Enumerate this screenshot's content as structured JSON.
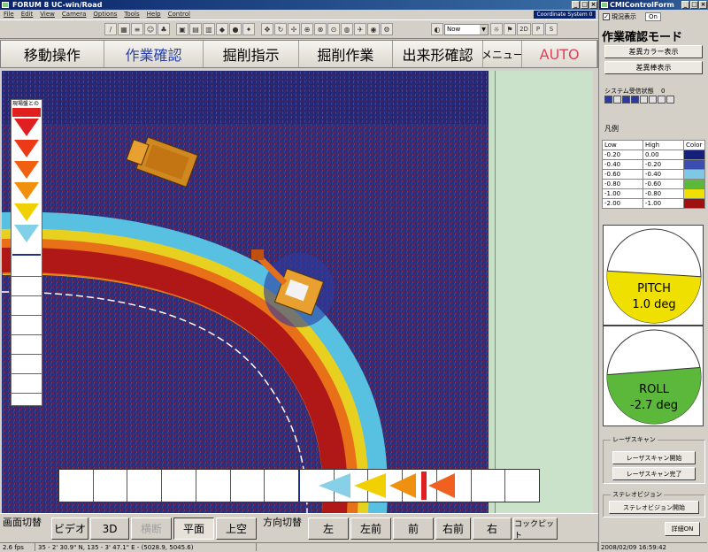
{
  "app": {
    "title": "FORUM 8   UC-win/Road"
  },
  "menu": [
    "File",
    "Edit",
    "View",
    "Camera",
    "Options",
    "Tools",
    "Help",
    "Control"
  ],
  "coord_system": "Coordinate System 0",
  "time_select": "Now",
  "view_buttons": [
    "2D",
    "P",
    "S"
  ],
  "modes": [
    {
      "label": "移動操作",
      "active": false
    },
    {
      "label": "作業確認",
      "active": true
    },
    {
      "label": "掘削指示",
      "active": false
    },
    {
      "label": "掘削作業",
      "active": false
    },
    {
      "label": "出来形確認",
      "active": false
    },
    {
      "label": "メニュー",
      "active": false
    },
    {
      "label": "AUTO",
      "active": false,
      "color": "#e0405a"
    }
  ],
  "legend_title": "現場盤との",
  "bottom_bar": {
    "screen_switch_label": "画面切替",
    "screen_buttons": [
      {
        "label": "ビデオ",
        "state": "normal"
      },
      {
        "label": "3D",
        "state": "normal"
      },
      {
        "label": "横断",
        "state": "disabled"
      },
      {
        "label": "平面",
        "state": "active"
      },
      {
        "label": "上空",
        "state": "normal"
      }
    ],
    "direction_switch_label": "方向切替",
    "direction_buttons": [
      "左",
      "左前",
      "前",
      "右前",
      "右",
      "コックピット"
    ]
  },
  "status": {
    "fps": "2.6 fps",
    "coords": "35 - 2' 30.9\" N, 135 - 3' 47.1\" E  -  (5028.9, 5045.6)",
    "datetime": "2008/02/09 16:59:42"
  },
  "panel": {
    "title": "CMIControlForm",
    "checkbox_label": "現況表示",
    "toggle": "On",
    "mode_title": "作業確認モード",
    "btn_color": "差異カラー表示",
    "btn_bar": "差異棒表示",
    "system_status_label": "システム受信状態",
    "system_status_value": "0",
    "legend_label": "凡例",
    "legend_headers": [
      "Low",
      "High",
      "Color"
    ],
    "legend_rows": [
      {
        "low": "-0.20",
        "high": "0.00",
        "color": "#14207a"
      },
      {
        "low": "-0.40",
        "high": "-0.20",
        "color": "#3b4db0"
      },
      {
        "low": "-0.60",
        "high": "-0.40",
        "color": "#7ec8e3"
      },
      {
        "low": "-0.80",
        "high": "-0.60",
        "color": "#5bb83a"
      },
      {
        "low": "-1.00",
        "high": "-0.80",
        "color": "#f0e000"
      },
      {
        "low": "-2.00",
        "high": "-1.00",
        "color": "#a01010"
      }
    ],
    "pitch_label": "PITCH",
    "pitch_value": "1.0 deg",
    "pitch_level": 0.45,
    "roll_label": "ROLL",
    "roll_value": "-2.7 deg",
    "roll_level": 0.45,
    "laser_group": "レーザスキャン",
    "laser_start": "レーザスキャン開始",
    "laser_stop": "レーザスキャン完了",
    "stereo_group": "ステレオビジョン",
    "stereo_start": "ステレオビジョン開始",
    "detail_button": "詳細ON"
  }
}
